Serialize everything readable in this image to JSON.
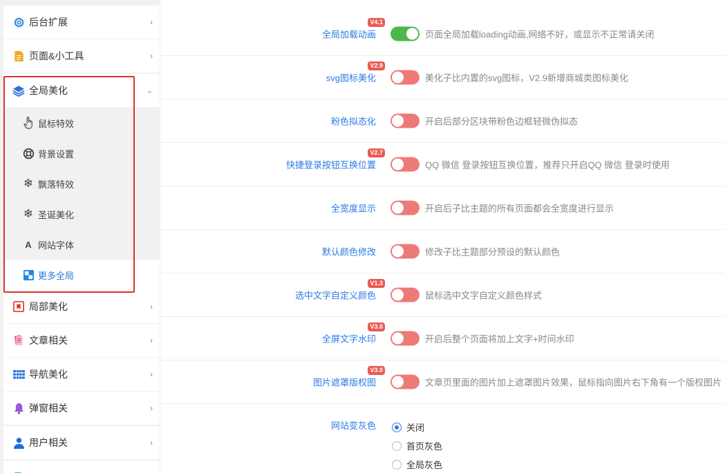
{
  "sidebar": {
    "items": [
      {
        "label": "后台扩展",
        "icon": "gear-icon"
      },
      {
        "label": "页面&小工具",
        "icon": "document-icon"
      },
      {
        "label": "全局美化",
        "icon": "layers-icon",
        "expanded": true
      },
      {
        "label": "局部美化",
        "icon": "bookmark-icon"
      },
      {
        "label": "文章相关",
        "icon": "article-icon"
      },
      {
        "label": "导航美化",
        "icon": "grid-icon"
      },
      {
        "label": "弹窗相关",
        "icon": "bell-icon"
      },
      {
        "label": "用户相关",
        "icon": "user-icon"
      }
    ],
    "submenu": [
      {
        "label": "鼠标特效",
        "icon": "pointer-hand-icon"
      },
      {
        "label": "背景设置",
        "icon": "lifebuoy-icon"
      },
      {
        "label": "飘落特效",
        "icon": "snowflake-icon"
      },
      {
        "label": "圣诞美化",
        "icon": "snowflake-icon"
      },
      {
        "label": "网站字体",
        "icon": "font-a-icon"
      },
      {
        "label": "更多全局",
        "icon": "squares-icon",
        "active": true
      }
    ]
  },
  "settings": [
    {
      "label": "全局加载动画",
      "version": "V4.1",
      "enabled": true,
      "description": "页面全局加载loading动画,网络不好，或显示不正常请关闭"
    },
    {
      "label": "svg图标美化",
      "version": "V2.9",
      "enabled": false,
      "description": "美化子比内置的svg图标，V2.9新增商城类图标美化"
    },
    {
      "label": "粉色拟态化",
      "version": "",
      "enabled": false,
      "description": "开启后部分区块带粉色边框轻微伪拟态"
    },
    {
      "label": "快捷登录按钮互换位置",
      "version": "V2.7",
      "enabled": false,
      "description": "QQ 微信 登录按钮互换位置，推荐只开启QQ 微信 登录时使用"
    },
    {
      "label": "全宽度显示",
      "version": "",
      "enabled": false,
      "description": "开启后子比主题的所有页面都会全宽度进行显示"
    },
    {
      "label": "默认颜色修改",
      "version": "",
      "enabled": false,
      "description": "修改子比主题部分预设的默认颜色"
    },
    {
      "label": "选中文字自定义颜色",
      "version": "V1.3",
      "enabled": false,
      "description": "鼠标选中文字自定义颜色样式"
    },
    {
      "label": "全屏文字水印",
      "version": "V3.0",
      "enabled": false,
      "description": "开启后整个页面将加上文字+时间水印"
    },
    {
      "label": "图片遮罩版权图",
      "version": "V3.0",
      "enabled": false,
      "description": "文章页里面的图片加上遮罩图片效果，鼠标指向图片右下角有一个版权图片"
    }
  ],
  "gray": {
    "label": "网站变灰色",
    "options": [
      "关闭",
      "首页灰色",
      "全局灰色"
    ],
    "selected": 0
  },
  "colors": {
    "accent": "#2c7be5",
    "toggle_on": "#4cb84c",
    "toggle_off": "#ee7a78",
    "badge": "#e85b55",
    "highlight": "#e0312b"
  }
}
